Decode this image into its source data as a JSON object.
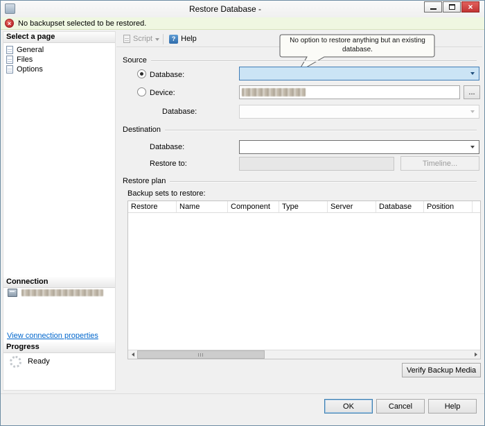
{
  "window": {
    "title": "Restore Database -"
  },
  "icons": {
    "close_glyph": "×",
    "error_glyph": "×",
    "help_glyph": "?"
  },
  "alert": {
    "message": "No backupset selected to be restored."
  },
  "sidebar": {
    "select_a_page": "Select a page",
    "pages": [
      {
        "label": "General"
      },
      {
        "label": "Files"
      },
      {
        "label": "Options"
      }
    ],
    "connection_header": "Connection",
    "view_connection_properties": "View connection properties",
    "progress_header": "Progress",
    "progress_status": "Ready"
  },
  "toolbar": {
    "script_label": "Script",
    "help_label": "Help"
  },
  "annotation": {
    "text": "No option to restore anything but an existing database."
  },
  "source": {
    "header": "Source",
    "database_radio_label": "Database:",
    "device_radio_label": "Device:",
    "device_browse_label": "...",
    "database_select_label": "Database:"
  },
  "destination": {
    "header": "Destination",
    "database_label": "Database:",
    "restore_to_label": "Restore to:",
    "timeline_button_label": "Timeline..."
  },
  "restore_plan": {
    "header": "Restore plan",
    "backup_sets_label": "Backup sets to restore:",
    "columns": [
      "Restore",
      "Name",
      "Component",
      "Type",
      "Server",
      "Database",
      "Position"
    ],
    "rows": [],
    "verify_button_label": "Verify Backup Media"
  },
  "footer": {
    "ok_label": "OK",
    "cancel_label": "Cancel",
    "help_label": "Help"
  },
  "colors": {
    "alert_bg": "#eff7e1",
    "focus_border": "#3f7cb6",
    "focus_fill": "#cbe4f5",
    "link": "#0066cc",
    "close_red": "#c23434"
  }
}
